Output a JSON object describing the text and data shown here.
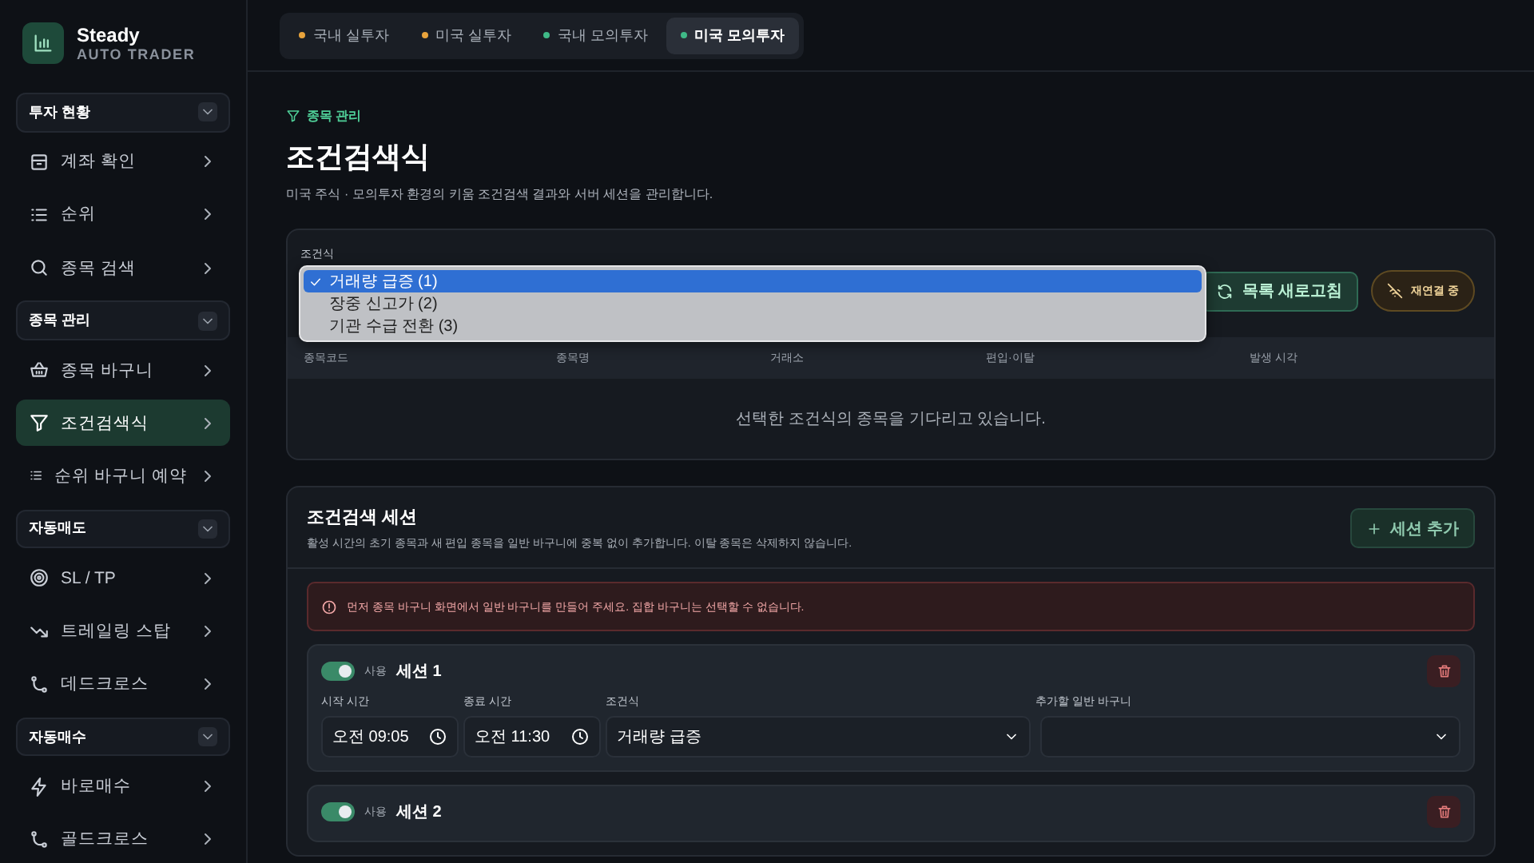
{
  "brand": {
    "name": "Steady",
    "tagline": "AUTO TRADER"
  },
  "sidebar": {
    "groups": [
      {
        "title": "투자 현황",
        "expanded": true,
        "items": [
          {
            "label": "계좌 확인",
            "selected": false
          },
          {
            "label": "순위",
            "selected": false
          },
          {
            "label": "종목 검색",
            "selected": false
          }
        ]
      },
      {
        "title": "종목 관리",
        "expanded": true,
        "items": [
          {
            "label": "종목 바구니",
            "selected": false
          },
          {
            "label": "조건검색식",
            "selected": true
          },
          {
            "label": "순위 바구니 예약",
            "selected": false
          }
        ]
      },
      {
        "title": "자동매도",
        "expanded": true,
        "items": [
          {
            "label": "SL / TP",
            "selected": false
          },
          {
            "label": "트레일링 스탑",
            "selected": false
          },
          {
            "label": "데드크로스",
            "selected": false
          }
        ]
      },
      {
        "title": "자동매수",
        "expanded": true,
        "items": [
          {
            "label": "바로매수",
            "selected": false
          },
          {
            "label": "골드크로스",
            "selected": false
          }
        ]
      }
    ]
  },
  "tabs": [
    {
      "label": "국내 실투자",
      "color": "#e8a33c",
      "selected": false
    },
    {
      "label": "미국 실투자",
      "color": "#e8a33c",
      "selected": false
    },
    {
      "label": "국내 모의투자",
      "color": "#3fb987",
      "selected": false
    },
    {
      "label": "미국 모의투자",
      "color": "#3fb987",
      "selected": true
    }
  ],
  "breadcrumb": "종목 관리",
  "title": "조건검색식",
  "description": "미국 주식 · 모의투자 환경의 키움 조건검색 결과와 서버 세션을 관리합니다.",
  "condition_panel": {
    "label": "조건식",
    "dropdown": {
      "open": true,
      "options": [
        {
          "label": "거래량 급증 (1)",
          "selected": true
        },
        {
          "label": "장중 신고가 (2)",
          "selected": false
        },
        {
          "label": "기관 수급 전환 (3)",
          "selected": false
        }
      ]
    },
    "refresh_button": "목록 새로고침",
    "connection_badge": "재연결 중",
    "table": {
      "columns": [
        "종목코드",
        "종목명",
        "거래소",
        "편입·이탈",
        "발생 시각"
      ],
      "empty_message": "선택한 조건식의 종목을 기다리고 있습니다."
    }
  },
  "sessions_panel": {
    "title": "조건검색 세션",
    "description": "활성 시간의 초기 종목과 새 편입 종목을 일반 바구니에 중복 없이 추가합니다. 이탈 종목은 삭제하지 않습니다.",
    "add_button": "세션 추가",
    "alert": "먼저 종목 바구니 화면에서 일반 바구니를 만들어 주세요. 집합 바구니는 선택할 수 없습니다.",
    "sessions": [
      {
        "enabled": true,
        "enabled_label": "사용",
        "name": "세션 1",
        "fields": {
          "start_time_label": "시작 시간",
          "start_time": "오전 09:05",
          "end_time_label": "종료 시간",
          "end_time": "오전 11:30",
          "condition_label": "조건식",
          "condition": "거래량 급증",
          "basket_label": "추가할 일반 바구니"
        }
      },
      {
        "enabled": true,
        "enabled_label": "사용",
        "name": "세션 2"
      }
    ]
  }
}
